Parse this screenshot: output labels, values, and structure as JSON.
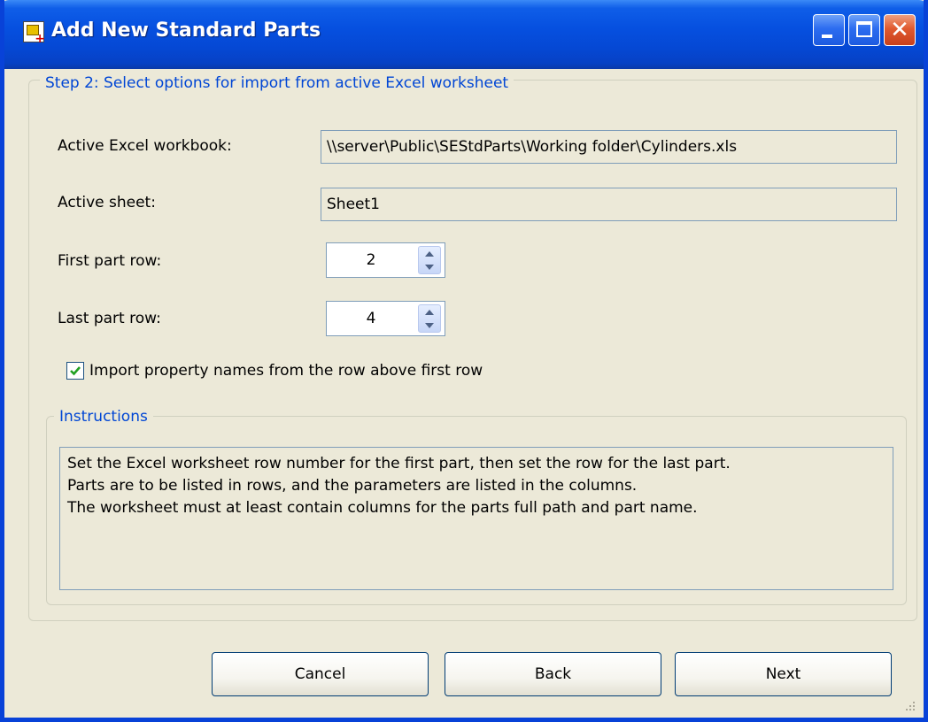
{
  "window": {
    "title": "Add New Standard Parts",
    "icon": "standard-parts-app-icon"
  },
  "step_group": {
    "legend": "Step 2: Select options for import from active Excel worksheet"
  },
  "fields": {
    "workbook_label": "Active Excel workbook:",
    "workbook_value": "\\\\server\\Public\\SEStdParts\\Working folder\\Cylinders.xls",
    "sheet_label": "Active sheet:",
    "sheet_value": "Sheet1",
    "first_row_label": "First part row:",
    "first_row_value": "2",
    "last_row_label": "Last part row:",
    "last_row_value": "4"
  },
  "checkbox": {
    "label": "Import property names from the row above first row",
    "checked": true
  },
  "instructions": {
    "legend": "Instructions",
    "lines": [
      "Set the Excel worksheet row number for the first part, then set the row for the last part.",
      "Parts are to be listed in rows, and the parameters are listed in the columns.",
      "The worksheet must at least contain columns for the parts full path and part name."
    ]
  },
  "buttons": {
    "cancel": "Cancel",
    "back": "Back",
    "next": "Next"
  }
}
